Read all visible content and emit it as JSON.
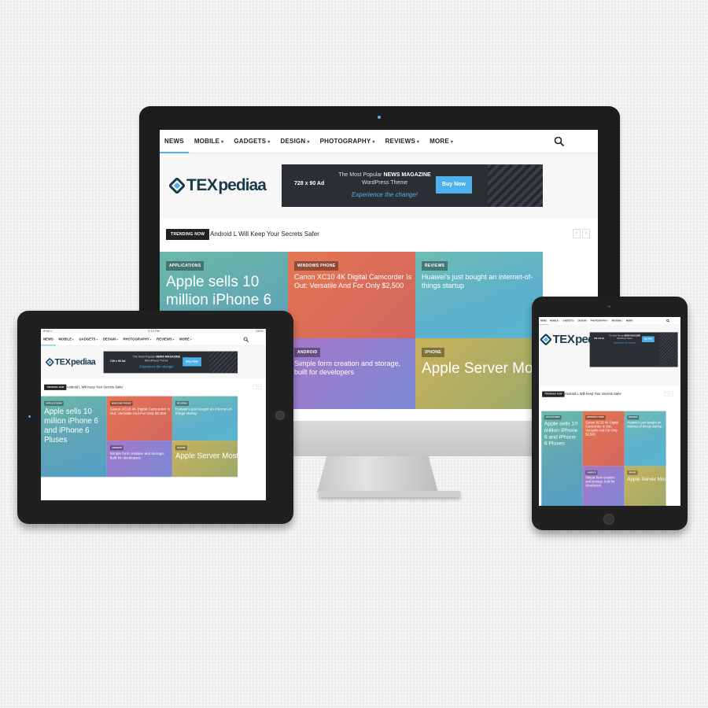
{
  "site": {
    "nav": [
      {
        "label": "NEWS",
        "caret": false
      },
      {
        "label": "MOBILE",
        "caret": true
      },
      {
        "label": "GADGETS",
        "caret": true
      },
      {
        "label": "DESIGN",
        "caret": true
      },
      {
        "label": "PHOTOGRAPHY",
        "caret": true
      },
      {
        "label": "REVIEWS",
        "caret": true
      },
      {
        "label": "MORE",
        "caret": true
      }
    ],
    "logo": {
      "part1": "TEX",
      "part2": "pediaa"
    },
    "ad": {
      "size": "728 x 90 Ad",
      "line1_prefix": "The Most Popular ",
      "line1_bold": "NEWS MAGAZINE",
      "line2": "WordPress Theme",
      "line3": "Experience the change!",
      "button": "Buy Now"
    },
    "trending": {
      "badge": "TRENDING NOW",
      "text": "Android L Will Keep Your Secrets Safer",
      "prev": "‹",
      "next": "›"
    },
    "tiles": [
      {
        "category": "APPLICATIONS",
        "title": "Apple sells 10 million iPhone 6 and iPhone 6 Pluses"
      },
      {
        "category": "WINDOWS PHONE",
        "title": "Canon XC10 4K Digital Camcorder Is Out: Versatile And For Only $2,500"
      },
      {
        "category": "REVIEWS",
        "title": "Huawei's just bought an internet-of-things startup"
      },
      {
        "category": "ANDROID",
        "title": "Simple form creation and storage, built for developers"
      },
      {
        "category": "IPHONE",
        "title": "Apple Server Most"
      }
    ]
  },
  "tablet_status": {
    "left": "iPad ≈",
    "center": "9:14 PM",
    "right": "100%"
  },
  "colors": {
    "accent": "#4db2ec",
    "logo": "#1b3a4b"
  }
}
